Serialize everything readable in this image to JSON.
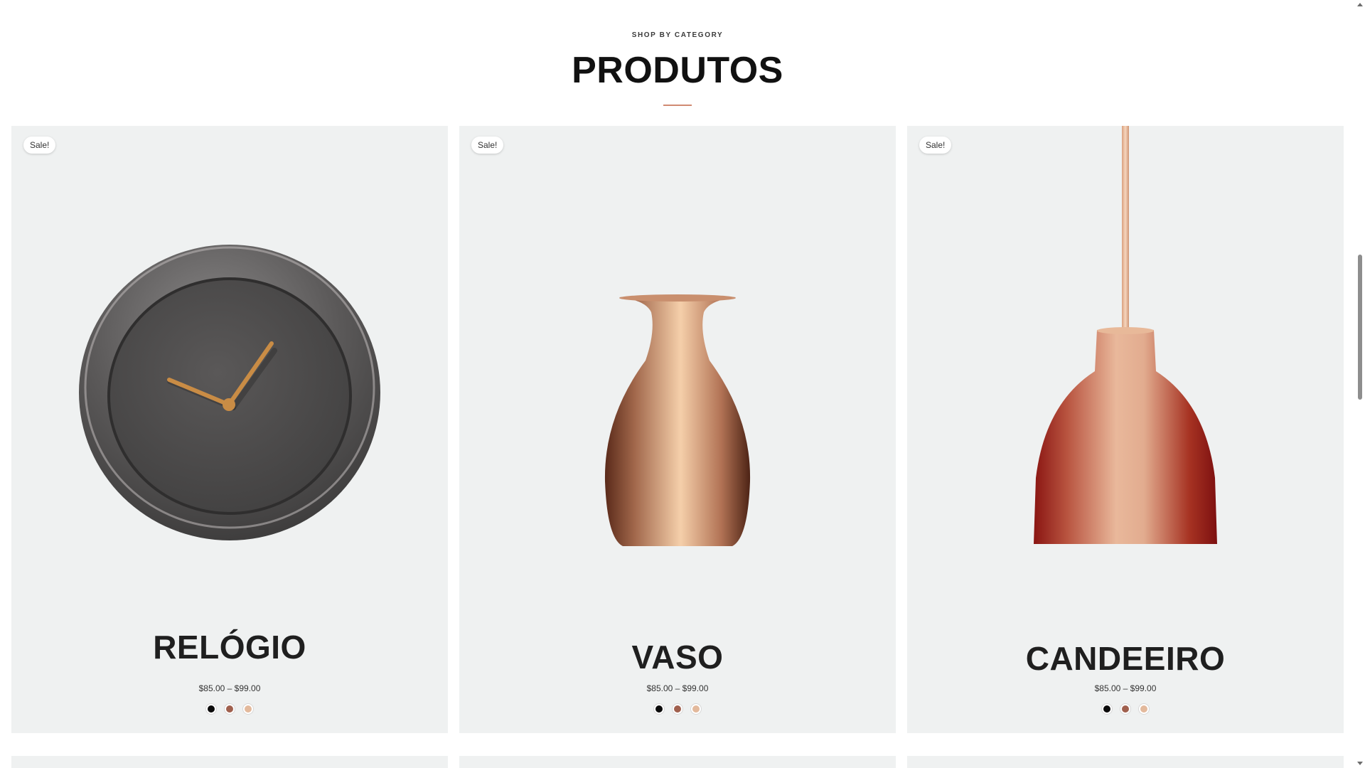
{
  "section": {
    "eyebrow": "SHOP BY CATEGORY",
    "title": "PRODUTOS",
    "accent_color": "#d08a72"
  },
  "products": [
    {
      "badge": "Sale!",
      "name": "RELÓGIO",
      "price": "$85.00 – $99.00",
      "image_icon": "wall-clock-icon",
      "swatches": [
        "#0b0b0b",
        "#a0604e",
        "#e3b99c"
      ]
    },
    {
      "badge": "Sale!",
      "name": "VASO",
      "price": "$85.00 – $99.00",
      "image_icon": "vase-icon",
      "swatches": [
        "#0b0b0b",
        "#a0604e",
        "#e3b99c"
      ]
    },
    {
      "badge": "Sale!",
      "name": "CANDEEIRO",
      "price": "$85.00 – $99.00",
      "image_icon": "pendant-lamp-icon",
      "swatches": [
        "#0b0b0b",
        "#a0604e",
        "#e3b99c"
      ]
    }
  ],
  "colors": {
    "card_background": "#eff1f1",
    "title_text": "#111111"
  }
}
